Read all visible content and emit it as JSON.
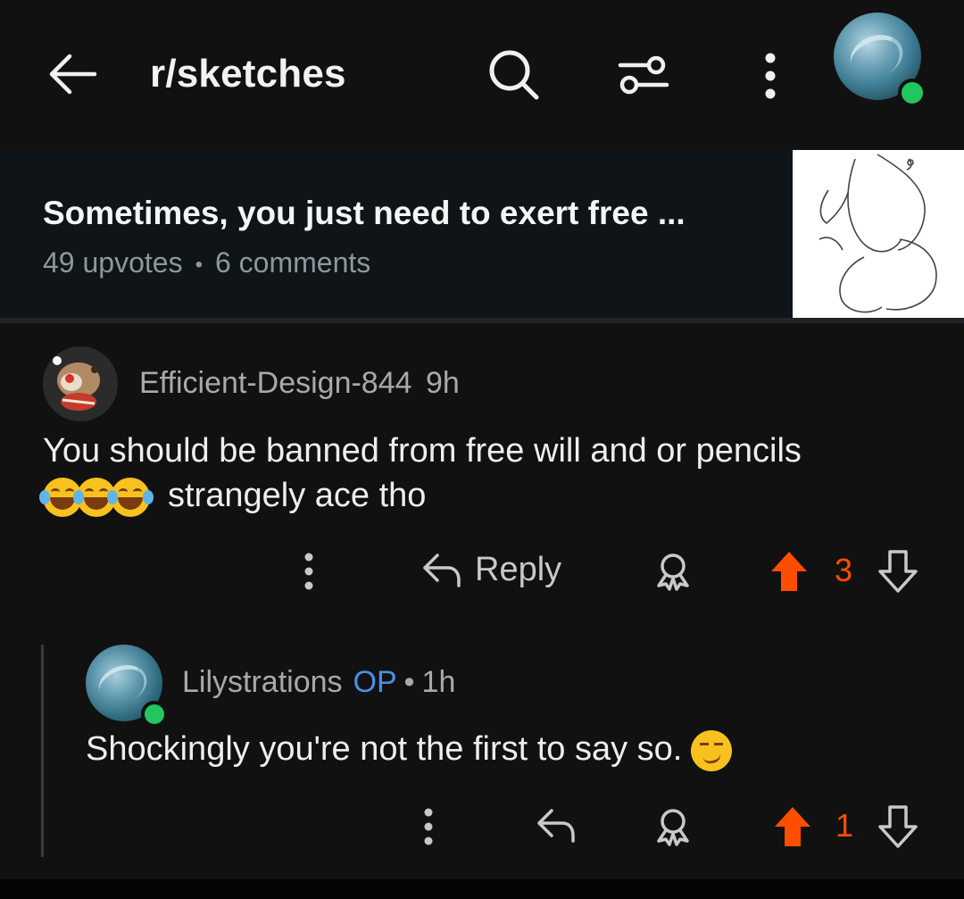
{
  "header": {
    "title": "r/sketches"
  },
  "post": {
    "title": "Sometimes, you just need to exert free ...",
    "upvotes": "49 upvotes",
    "comments": "6 comments"
  },
  "comments": [
    {
      "author": "Efficient-Design-844",
      "time": "9h",
      "text_line1": "You should be banned from free will and or pencils",
      "text_line2": "strangely ace tho",
      "reply_label": "Reply",
      "score": "3"
    },
    {
      "author": "Lilystrations",
      "badge": "OP",
      "separator": "•",
      "time": "1h",
      "text": "Shockingly you're not the first to say so.",
      "score": "1"
    }
  ],
  "colors": {
    "background": "#111111",
    "upvote": "#ff4d00",
    "op_badge": "#4a90e2",
    "online": "#23c55e"
  },
  "icons": [
    "back-arrow-icon",
    "search-icon",
    "filter-icon",
    "more-vertical-icon",
    "reply-icon",
    "award-icon",
    "upvote-icon",
    "downvote-icon",
    "laughing-tears-emoji",
    "smirk-emoji"
  ]
}
